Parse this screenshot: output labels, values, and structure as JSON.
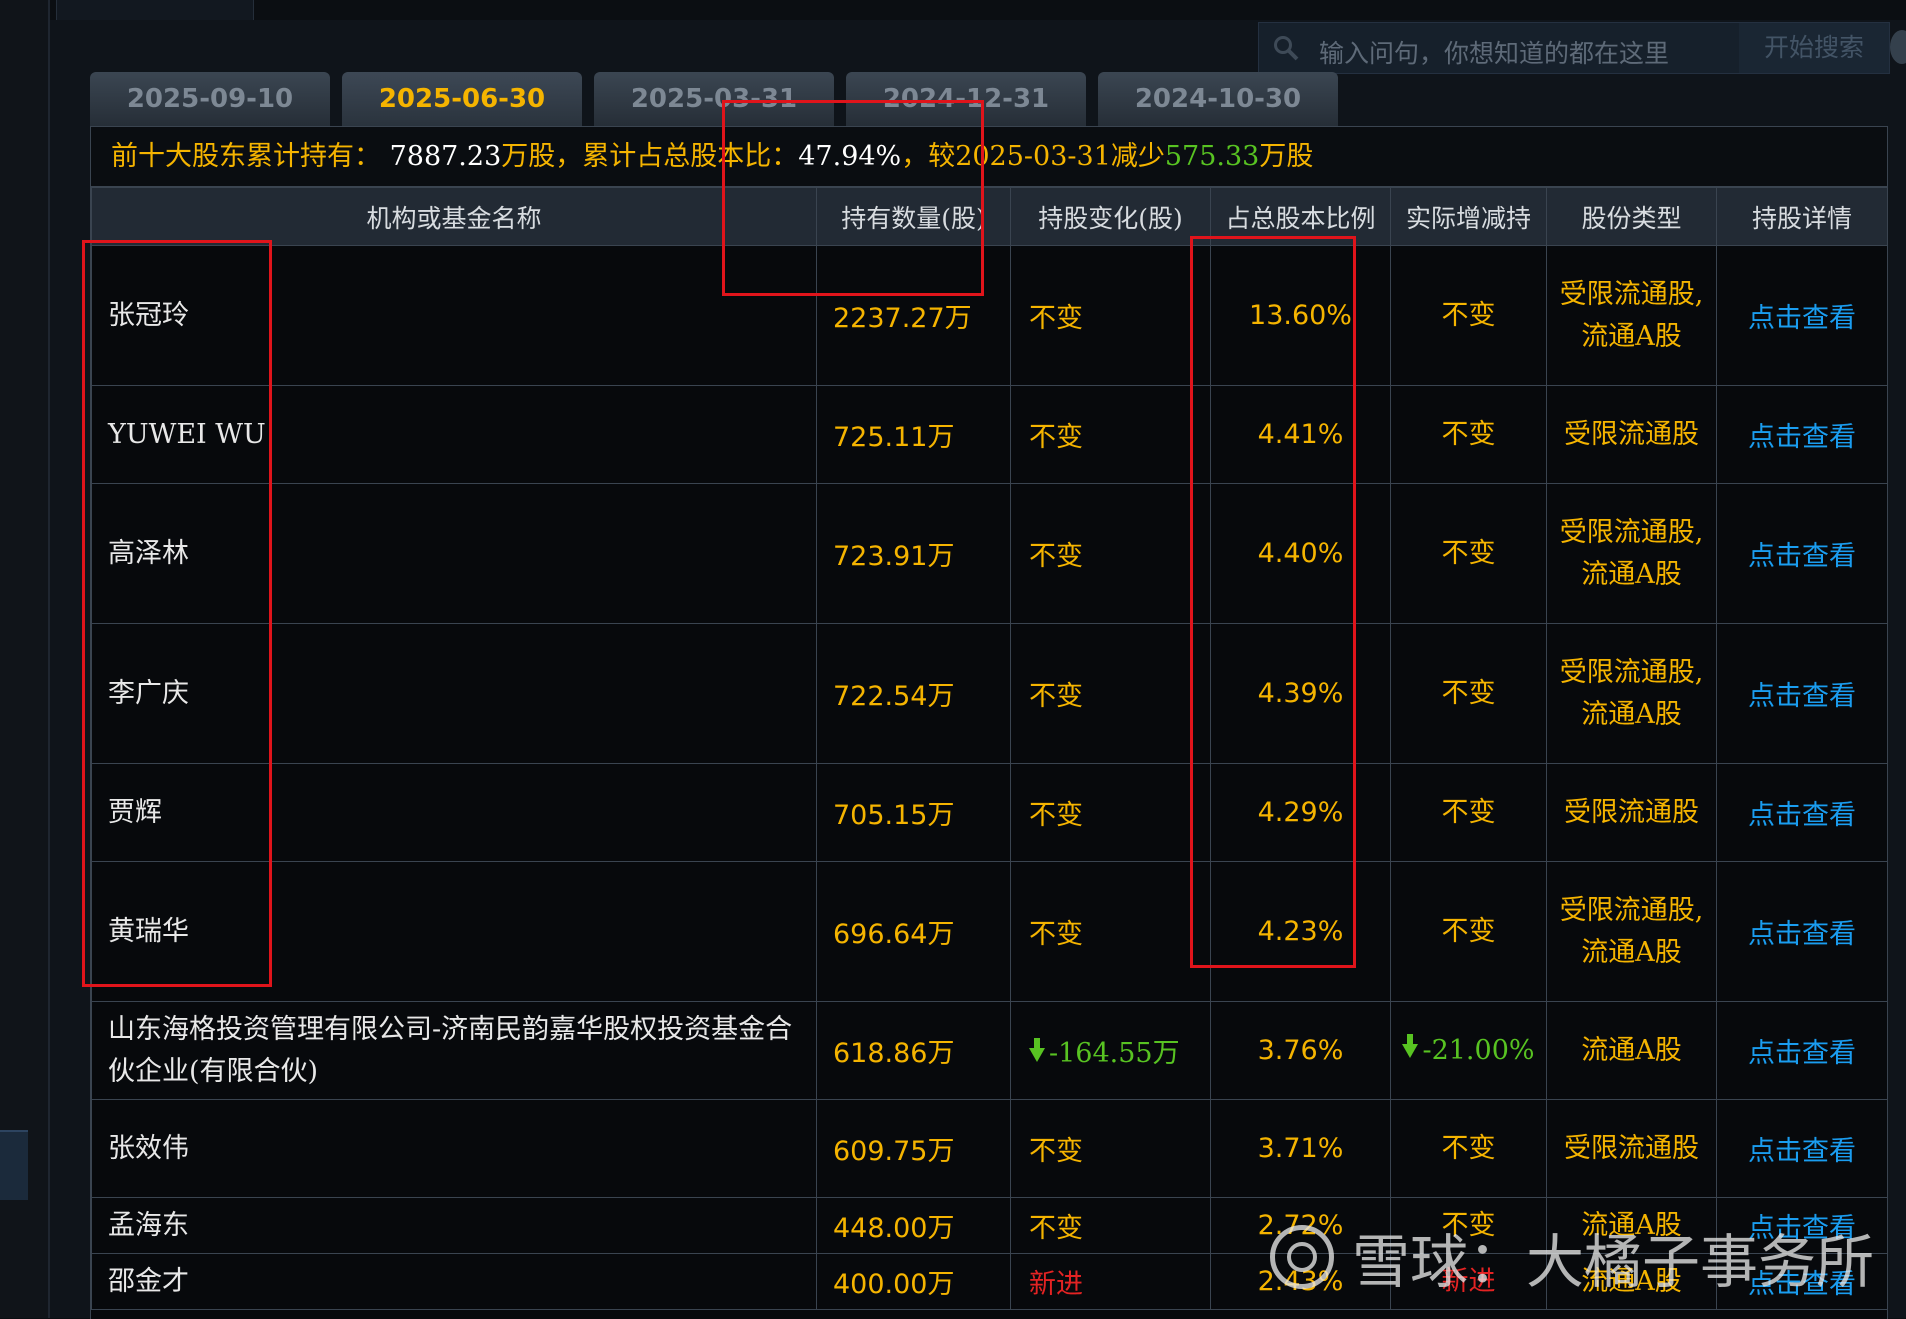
{
  "search": {
    "placeholder": "输入问句，你想知道的都在这里",
    "button": "开始搜索"
  },
  "tabs": [
    {
      "label": "2025-09-10",
      "active": false
    },
    {
      "label": "2025-06-30",
      "active": true
    },
    {
      "label": "2025-03-31",
      "active": false
    },
    {
      "label": "2024-12-31",
      "active": false
    },
    {
      "label": "2024-10-30",
      "active": false
    }
  ],
  "summary": {
    "prefix": "前十大股东累计持有：",
    "total": "7887.23",
    "unit1": "万股，",
    "ratio_label": "累计占总股本比：",
    "ratio": "47.94%",
    "compare": "，较2025-03-31减少",
    "change": "575.33",
    "unit2": "万股"
  },
  "table": {
    "headers": [
      "机构或基金名称",
      "持有数量(股)",
      "持股变化(股)",
      "占总股本比例",
      "实际增减持",
      "股份类型",
      "持股详情"
    ],
    "rows": [
      {
        "name": "张冠玲",
        "hold": "2237.27万",
        "change": "不变",
        "pct": "13.60%",
        "actual": "不变",
        "type": "受限流通股,流通A股",
        "detail": "点击查看"
      },
      {
        "name": "YUWEI WU",
        "hold": "725.11万",
        "change": "不变",
        "pct": "4.41%",
        "actual": "不变",
        "type": "受限流通股",
        "detail": "点击查看"
      },
      {
        "name": "高泽林",
        "hold": "723.91万",
        "change": "不变",
        "pct": "4.40%",
        "actual": "不变",
        "type": "受限流通股,流通A股",
        "detail": "点击查看"
      },
      {
        "name": "李广庆",
        "hold": "722.54万",
        "change": "不变",
        "pct": "4.39%",
        "actual": "不变",
        "type": "受限流通股,流通A股",
        "detail": "点击查看"
      },
      {
        "name": "贾辉",
        "hold": "705.15万",
        "change": "不变",
        "pct": "4.29%",
        "actual": "不变",
        "type": "受限流通股",
        "detail": "点击查看"
      },
      {
        "name": "黄瑞华",
        "hold": "696.64万",
        "change": "不变",
        "pct": "4.23%",
        "actual": "不变",
        "type": "受限流通股,流通A股",
        "detail": "点击查看"
      },
      {
        "name": "山东海格投资管理有限公司-济南民韵嘉华股权投资基金合伙企业(有限合伙)",
        "hold": "618.86万",
        "change": "-164.55万",
        "pct": "3.76%",
        "actual": "-21.00%",
        "type": "流通A股",
        "detail": "点击查看"
      },
      {
        "name": "张效伟",
        "hold": "609.75万",
        "change": "不变",
        "pct": "3.71%",
        "actual": "不变",
        "type": "受限流通股",
        "detail": "点击查看"
      },
      {
        "name": "孟海东",
        "hold": "448.00万",
        "change": "不变",
        "pct": "2.72%",
        "actual": "不变",
        "type": "流通A股",
        "detail": "点击查看"
      },
      {
        "name": "邵金才",
        "hold": "400.00万",
        "change": "新进",
        "pct": "2.43%",
        "actual": "新进",
        "type": "流通A股",
        "detail": "点击查看"
      }
    ]
  },
  "watermark": "雪球：大橘子事务所",
  "colors": {
    "accent": "#f5b400",
    "link": "#1a9df0",
    "up_green": "#58c322",
    "new_red": "#e42323",
    "annotation": "#e0141b"
  }
}
